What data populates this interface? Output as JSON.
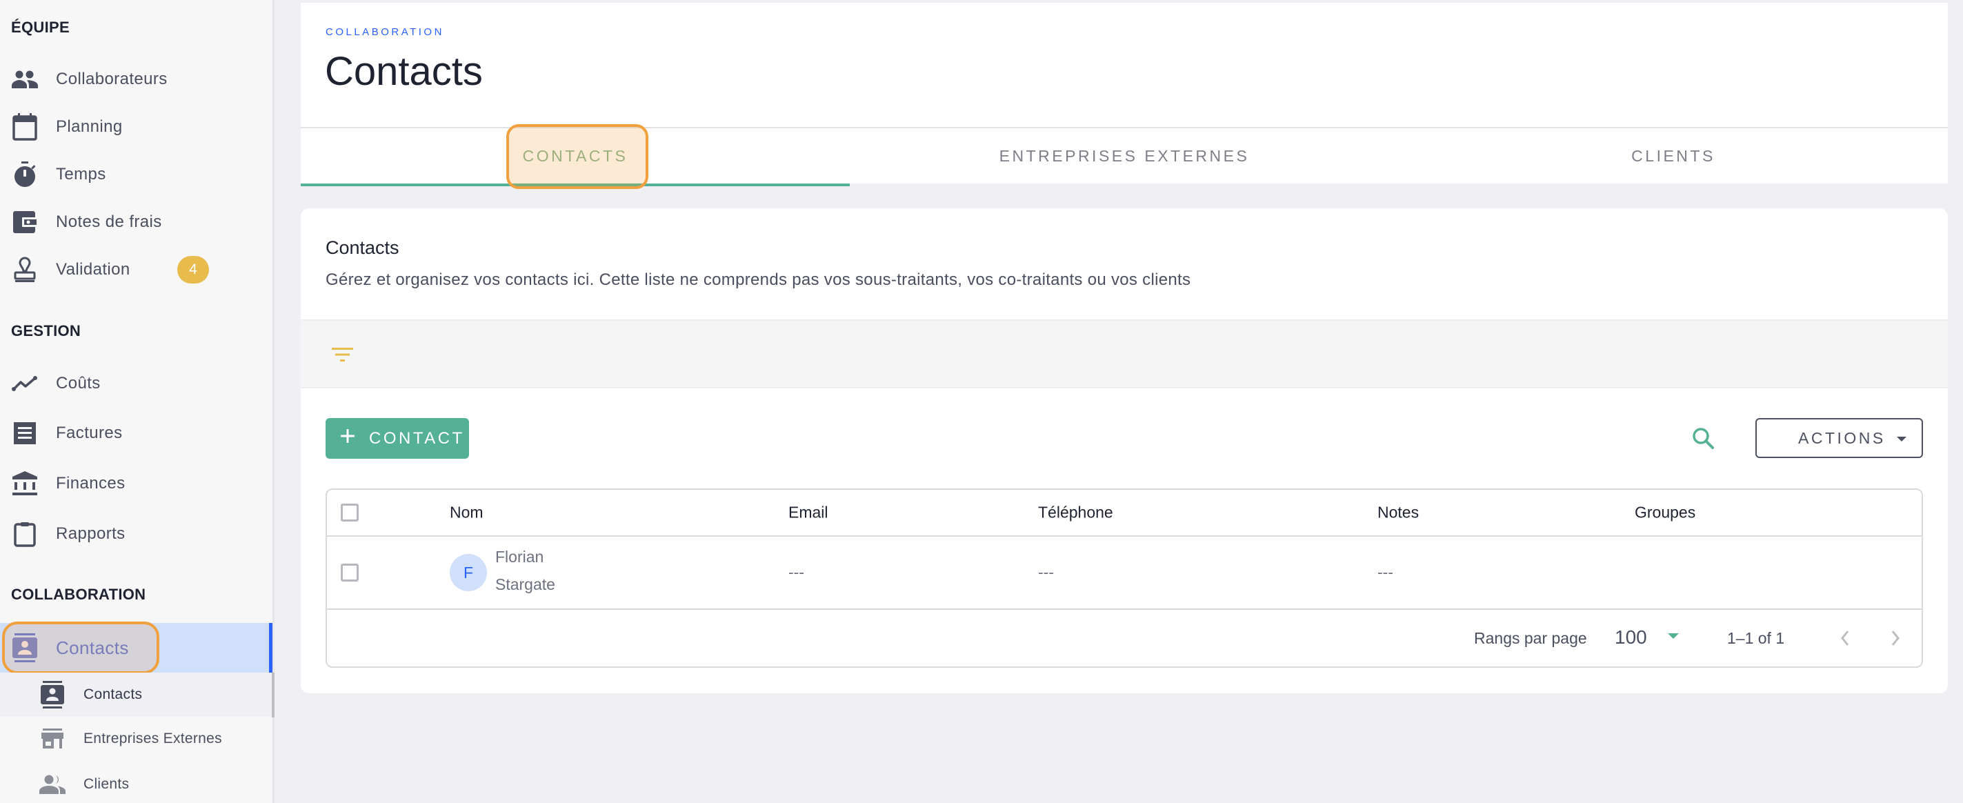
{
  "sidebar": {
    "sections": [
      {
        "title": "ÉQUIPE"
      },
      {
        "title": "GESTION"
      },
      {
        "title": "COLLABORATION"
      }
    ],
    "equipe_items": [
      {
        "label": "Collaborateurs",
        "icon": "people-icon"
      },
      {
        "label": "Planning",
        "icon": "calendar-icon"
      },
      {
        "label": "Temps",
        "icon": "stopwatch-icon"
      },
      {
        "label": "Notes de frais",
        "icon": "wallet-icon"
      },
      {
        "label": "Validation",
        "icon": "stamp-icon",
        "badge": "4"
      }
    ],
    "gestion_items": [
      {
        "label": "Coûts",
        "icon": "trending-line-icon"
      },
      {
        "label": "Factures",
        "icon": "receipt-icon"
      },
      {
        "label": "Finances",
        "icon": "bank-icon"
      },
      {
        "label": "Rapports",
        "icon": "clipboard-icon"
      }
    ],
    "collaboration_items": [
      {
        "label": "Contacts",
        "icon": "contacts-icon",
        "active": true
      }
    ],
    "sub_items": [
      {
        "label": "Contacts",
        "icon": "contacts-icon",
        "current": true
      },
      {
        "label": "Entreprises Externes",
        "icon": "store-icon"
      },
      {
        "label": "Clients",
        "icon": "people-icon"
      }
    ]
  },
  "header": {
    "overline": "COLLABORATION",
    "title": "Contacts",
    "tabs": [
      {
        "label": "CONTACTS",
        "active": true
      },
      {
        "label": "ENTREPRISES EXTERNES"
      },
      {
        "label": "CLIENTS"
      }
    ]
  },
  "card": {
    "title": "Contacts",
    "description": "Gérez et organisez vos contacts ici. Cette liste ne comprends pas vos sous-traitants, vos co-traitants ou vos clients",
    "add_button_label": "CONTACT",
    "actions_label": "ACTIONS"
  },
  "table": {
    "columns": [
      "Nom",
      "Email",
      "Téléphone",
      "Notes",
      "Groupes"
    ],
    "rows": [
      {
        "avatar_initial": "F",
        "name": "Florian",
        "company": "Stargate",
        "email": "---",
        "phone": "---",
        "notes": "---",
        "groups": ""
      }
    ],
    "footer": {
      "rows_per_page_label": "Rangs par page",
      "rows_per_page": "100",
      "range": "1–1 of 1"
    }
  },
  "colors": {
    "accent_green": "#55b195",
    "accent_blue": "#2962ff",
    "badge_yellow": "#e8bb4c",
    "highlight_orange": "#f0a03c"
  }
}
